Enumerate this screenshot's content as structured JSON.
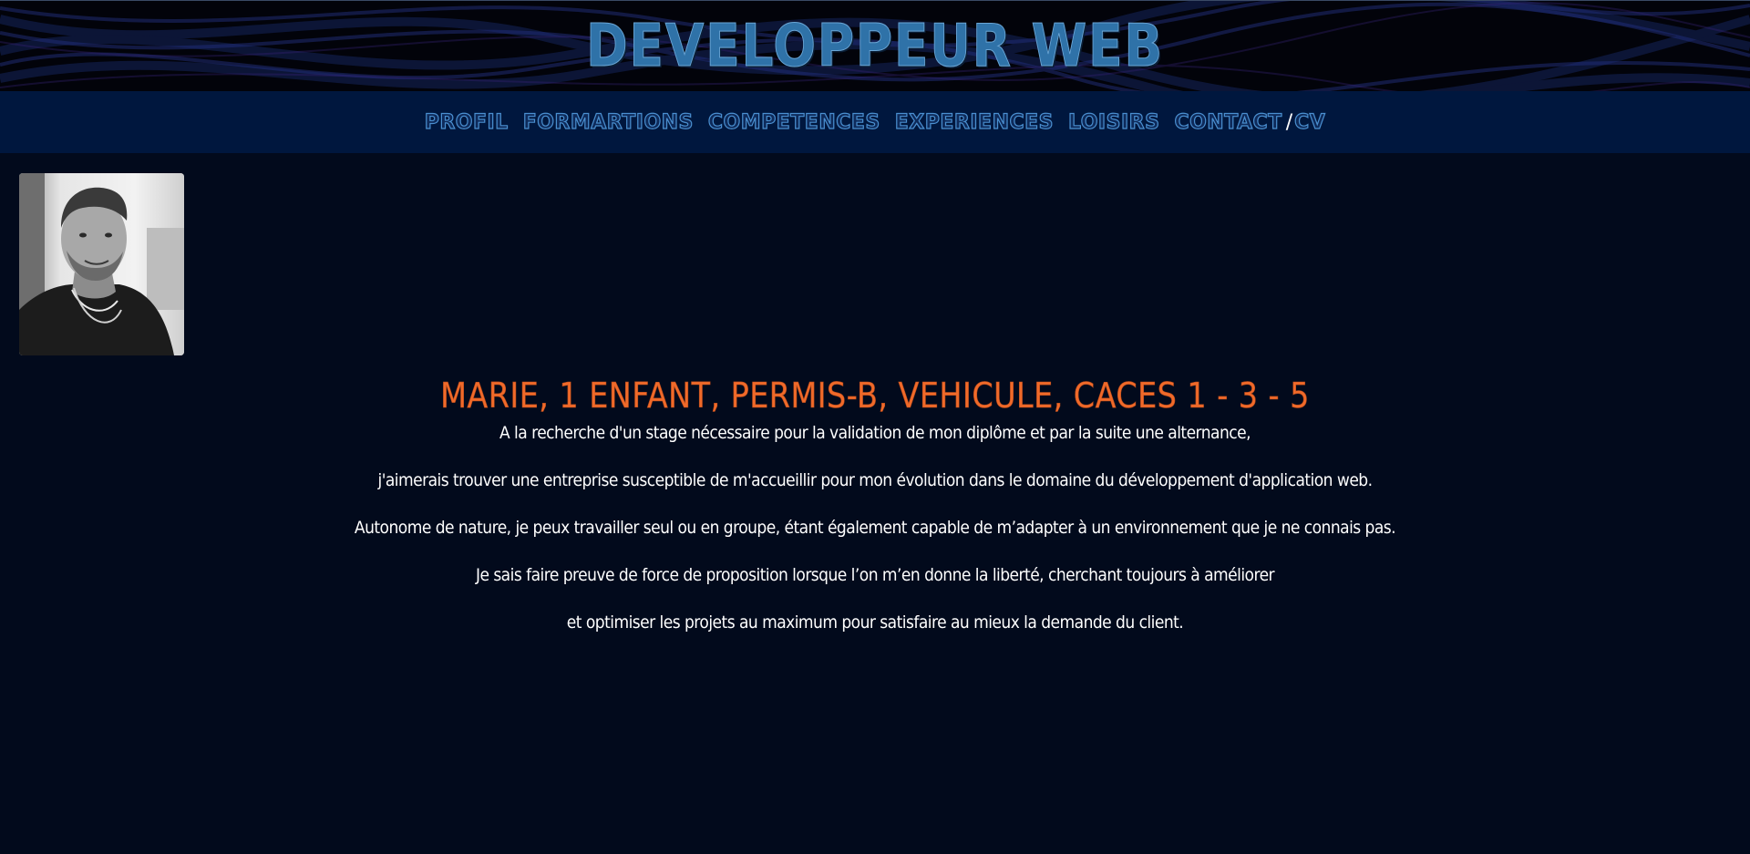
{
  "header": {
    "title": "DEVELOPPEUR WEB"
  },
  "nav": {
    "items": [
      {
        "label": "PROFIL"
      },
      {
        "label": "FORMARTIONS"
      },
      {
        "label": "COMPETENCES"
      },
      {
        "label": "EXPERIENCES"
      },
      {
        "label": "LOISIRS"
      },
      {
        "label": "CONTACT"
      }
    ],
    "separator": "/",
    "cv": "CV"
  },
  "profile": {
    "headline": "MARIE, 1 ENFANT, PERMIS-B, VEHICULE, CACES 1 - 3 - 5",
    "bio": [
      "A la recherche d'un stage nécessaire pour la validation de mon diplôme et par la suite une alternance,",
      "j'aimerais trouver une entreprise susceptible de m'accueillir pour mon évolution dans le domaine du développement d'application web.",
      "Autonome de nature, je peux travailler seul ou en groupe, étant également capable de m’adapter à un environnement que je ne connais pas.",
      "Je sais faire preuve de force de proposition lorsque l’on m’en donne la liberté, cherchant toujours à améliorer",
      "et optimiser les projets au maximum pour satisfaire au mieux la demande du client."
    ]
  },
  "colors": {
    "page_bg": "#020a1c",
    "nav_bg": "#00173e",
    "title": "#2f72a8",
    "nav_text": "#4a8fd0",
    "headline": "#f06a2a",
    "bio_text": "#ffffff"
  }
}
